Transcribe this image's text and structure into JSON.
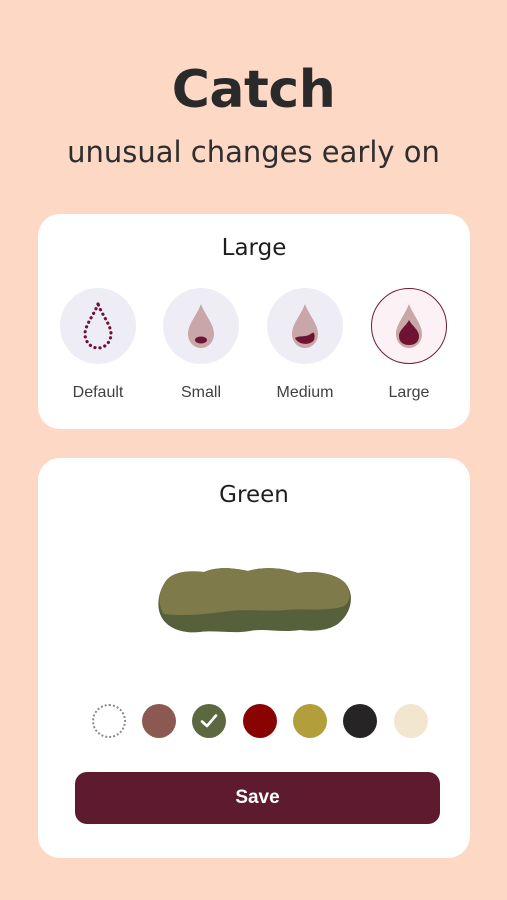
{
  "headline": "Catch",
  "subheadline": "unusual changes early on",
  "size_card": {
    "title": "Large",
    "options": [
      {
        "label": "Default",
        "icon": "drop-outline-icon",
        "selected": false
      },
      {
        "label": "Small",
        "icon": "drop-small-icon",
        "selected": false
      },
      {
        "label": "Medium",
        "icon": "drop-medium-icon",
        "selected": false
      },
      {
        "label": "Large",
        "icon": "drop-large-icon",
        "selected": true
      }
    ]
  },
  "color_card": {
    "title": "Green",
    "preview_icon": "stool-shape-icon",
    "swatches": [
      {
        "color": "#FFFFFF",
        "selected": false,
        "style": "dotted"
      },
      {
        "color": "#8B5852",
        "selected": false
      },
      {
        "color": "#5D6840",
        "selected": true,
        "icon": "checkmark-icon"
      },
      {
        "color": "#8A0303",
        "selected": false
      },
      {
        "color": "#B29E3A",
        "selected": false
      },
      {
        "color": "#262424",
        "selected": false
      },
      {
        "color": "#F3E6CE",
        "selected": false
      }
    ],
    "save_label": "Save"
  },
  "colors": {
    "background": "#FCD8C5",
    "accent": "#5E1A2E",
    "drop_fill": "#C9A6A8",
    "drop_blood": "#6E1432"
  }
}
